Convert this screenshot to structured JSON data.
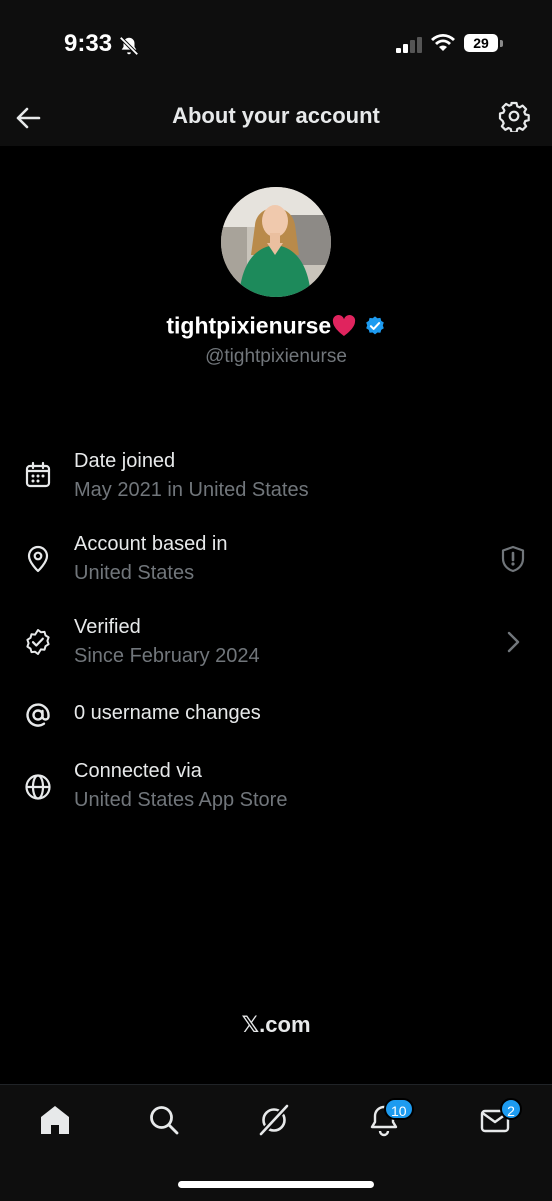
{
  "status_bar": {
    "time": "9:33",
    "battery": "29"
  },
  "nav": {
    "title": "About your account"
  },
  "profile": {
    "display_name": "tightpixienurse",
    "handle": "@tightpixienurse"
  },
  "info_rows": [
    {
      "title": "Date joined",
      "subtitle": "May 2021 in United States"
    },
    {
      "title": "Account based in",
      "subtitle": "United States"
    },
    {
      "title": "Verified",
      "subtitle": "Since February 2024"
    },
    {
      "title": "0 username changes"
    },
    {
      "title": "Connected via",
      "subtitle": "United States App Store"
    }
  ],
  "footer": {
    "brand": "𝕏.com"
  },
  "tab_bar": {
    "notifications_badge": "10",
    "messages_badge": "2"
  },
  "icons": [
    "back-arrow-icon",
    "settings-gear-icon",
    "calendar-icon",
    "location-pin-icon",
    "shield-alert-icon",
    "verified-badge-icon",
    "chevron-right-icon",
    "at-sign-icon",
    "globe-icon",
    "home-icon",
    "search-icon",
    "grok-icon",
    "notifications-bell-icon",
    "messages-icon"
  ],
  "colors": {
    "background": "#000000",
    "text_primary": "#e7e9ea",
    "text_secondary": "#71767b",
    "accent": "#1d9bf0",
    "heart": "#e0245e"
  }
}
